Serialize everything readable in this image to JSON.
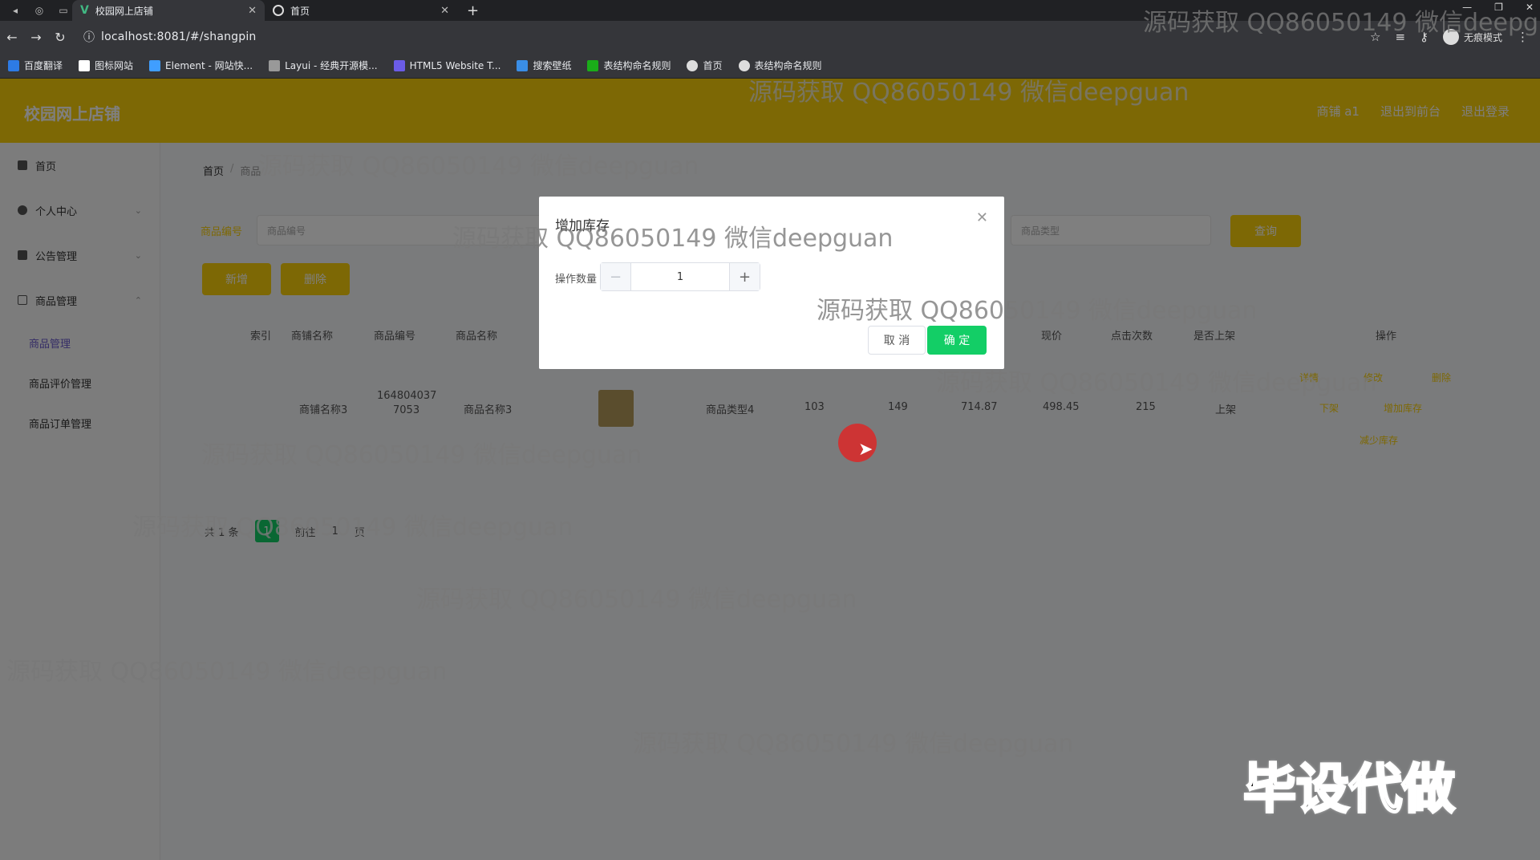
{
  "browser": {
    "tabs": [
      {
        "title": "校园网上店铺",
        "active": true
      },
      {
        "title": "首页",
        "active": false
      }
    ],
    "url": "localhost:8081/#/shangpin",
    "incognito_label": "无痕模式",
    "bookmarks": [
      "百度翻译",
      "图标网站",
      "Element - 网站快...",
      "Layui - 经典开源模...",
      "HTML5 Website T...",
      "搜索壁纸",
      "表结构命名规则",
      "首页",
      "表结构命名规则"
    ]
  },
  "header": {
    "logo": "校园网上店铺",
    "links": [
      "商铺 a1",
      "退出到前台",
      "退出登录"
    ]
  },
  "sidebar": {
    "items": [
      {
        "label": "首页"
      },
      {
        "label": "个人中心"
      },
      {
        "label": "公告管理"
      },
      {
        "label": "商品管理"
      }
    ],
    "sub_items": [
      "商品管理",
      "商品评价管理",
      "商品订单管理"
    ]
  },
  "breadcrumb": {
    "home": "首页",
    "current": "商品"
  },
  "search": {
    "label1": "商品编号",
    "placeholder1": "商品编号",
    "placeholder2": "商品类型",
    "query_button": "查询"
  },
  "actions": {
    "add": "新增",
    "delete": "删除"
  },
  "table": {
    "headers": [
      "索引",
      "商铺名称",
      "商品编号",
      "商品名称",
      "现价",
      "点击次数",
      "是否上架",
      "操作"
    ],
    "row": {
      "shop": "商铺名称3",
      "code_line1": "164804037",
      "code_line2": "7053",
      "name": "商品名称3",
      "type": "商品类型4",
      "num1": "103",
      "num2": "149",
      "price1": "714.87",
      "price2": "498.45",
      "clicks": "215",
      "status": "上架",
      "ops": [
        "详情",
        "修改",
        "删除",
        "下架",
        "增加库存",
        "减少库存"
      ]
    }
  },
  "pager": {
    "total": "共 1 条",
    "current": "1",
    "goto": "前往",
    "page": "1",
    "suffix": "页"
  },
  "modal": {
    "title": "增加库存",
    "label": "操作数量",
    "value": "1",
    "cancel": "取 消",
    "ok": "确 定"
  },
  "watermark": "源码获取 QQ86050149 微信deepguan",
  "stamp": "毕设代做"
}
